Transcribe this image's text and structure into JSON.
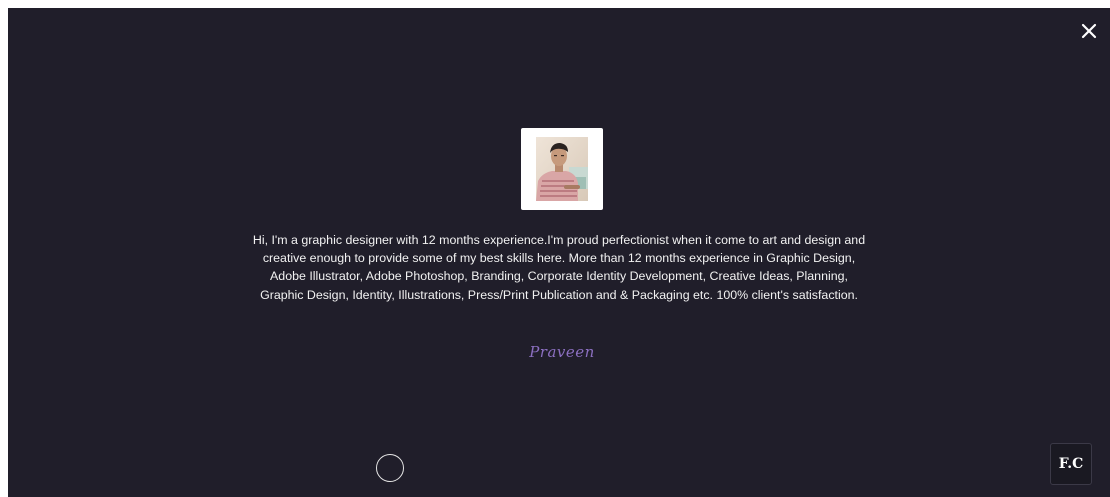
{
  "profile": {
    "bio": "Hi, I'm a graphic designer with 12 months experience.I'm proud perfectionist when it come to art and design and creative enough to provide some of my best skills here. More than 12 months experience in Graphic Design, Adobe Illustrator, Adobe Photoshop, Branding, Corporate Identity Development, Creative Ideas, Planning, Graphic Design, Identity, Illustrations, Press/Print Publication and & Packaging etc. 100% client's satisfaction.",
    "signature": "Praveen"
  },
  "logo": {
    "text": "F.C"
  },
  "icons": {
    "close": "close-icon",
    "cursor": "circle-cursor-icon"
  },
  "colors": {
    "background": "#201e2a",
    "text": "#f2f2f2",
    "signature": "#8b6fc0",
    "badge_bg": "#1a1922"
  }
}
